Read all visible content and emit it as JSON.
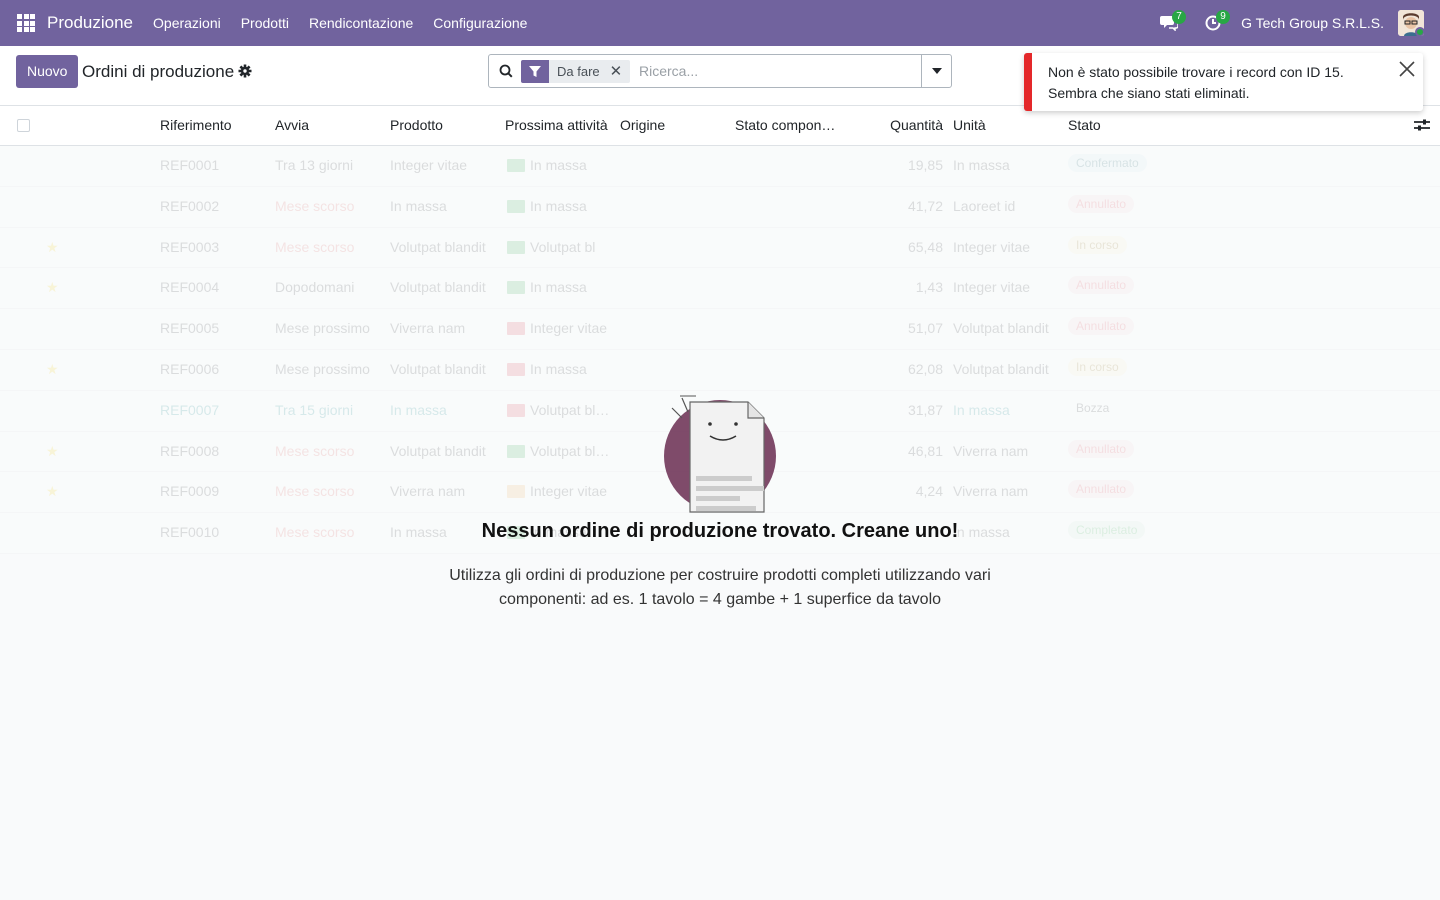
{
  "navbar": {
    "brand": "Produzione",
    "menu": [
      "Operazioni",
      "Prodotti",
      "Rendicontazione",
      "Configurazione"
    ],
    "messages_count": "7",
    "activities_count": "9",
    "company": "G Tech Group S.R.L.S."
  },
  "control_panel": {
    "new_button": "Nuovo",
    "title": "Ordini di produzione",
    "search_facet": "Da fare",
    "search_placeholder": "Ricerca..."
  },
  "list": {
    "columns": [
      "Riferimento",
      "Avvia",
      "Prodotto",
      "Prossima attività",
      "Origine",
      "Stato compon…",
      "Quantità",
      "Unità",
      "Stato"
    ],
    "rows": [
      {
        "starred": false,
        "ref": "REF0001",
        "start": "Tra 13 giorni",
        "product": "Integer vitae",
        "activity": "In massa",
        "qty": "19,85",
        "uom": "In massa",
        "state": "Confermato"
      },
      {
        "starred": false,
        "ref": "REF0002",
        "start": "Mese scorso",
        "product": "In massa",
        "activity": "In massa",
        "qty": "41,72",
        "uom": "Laoreet id",
        "state": "Annullato"
      },
      {
        "starred": true,
        "ref": "REF0003",
        "start": "Mese scorso",
        "product": "Volutpat blandit",
        "activity": "Volutpat bl",
        "qty": "65,48",
        "uom": "Integer vitae",
        "state": "In corso"
      },
      {
        "starred": true,
        "ref": "REF0004",
        "start": "Dopodomani",
        "product": "Volutpat blandit",
        "activity": "In massa",
        "qty": "1,43",
        "uom": "Integer vitae",
        "state": "Annullato"
      },
      {
        "starred": false,
        "ref": "REF0005",
        "start": "Mese prossimo",
        "product": "Viverra nam",
        "activity": "Integer vitae",
        "qty": "51,07",
        "uom": "Volutpat blandit",
        "state": "Annullato"
      },
      {
        "starred": true,
        "ref": "REF0006",
        "start": "Mese prossimo",
        "product": "Volutpat blandit",
        "activity": "In massa",
        "qty": "62,08",
        "uom": "Volutpat blandit",
        "state": "In corso"
      },
      {
        "starred": false,
        "ref": "REF0007",
        "start": "Tra 15 giorni",
        "product": "In massa",
        "activity": "Volutpat bl…",
        "qty": "31,87",
        "uom": "In massa",
        "state": "Bozza"
      },
      {
        "starred": true,
        "ref": "REF0008",
        "start": "Mese scorso",
        "product": "Volutpat blandit",
        "activity": "Volutpat bl…",
        "qty": "46,81",
        "uom": "Viverra nam",
        "state": "Annullato"
      },
      {
        "starred": true,
        "ref": "REF0009",
        "start": "Mese scorso",
        "product": "Viverra nam",
        "activity": "Integer vitae",
        "qty": "4,24",
        "uom": "Viverra nam",
        "state": "Annullato"
      },
      {
        "starred": false,
        "ref": "REF0010",
        "start": "Mese scorso",
        "product": "In massa",
        "activity": "In massa",
        "qty": "",
        "uom": "In massa",
        "state": "Completato"
      }
    ]
  },
  "help": {
    "title": "Nessun ordine di produzione trovato. Creane uno!",
    "text": "Utilizza gli ordini di produzione per costruire prodotti completi utilizzando vari componenti: ad es. 1 tavolo = 4 gambe + 1 superfice da tavolo"
  },
  "notification": {
    "message": "Non è stato possibile trovare i record con ID 15. Sembra che siano stati eliminati."
  },
  "colors": {
    "brand": "#71639e",
    "danger": "#e4282a",
    "badge": "#28a745"
  }
}
